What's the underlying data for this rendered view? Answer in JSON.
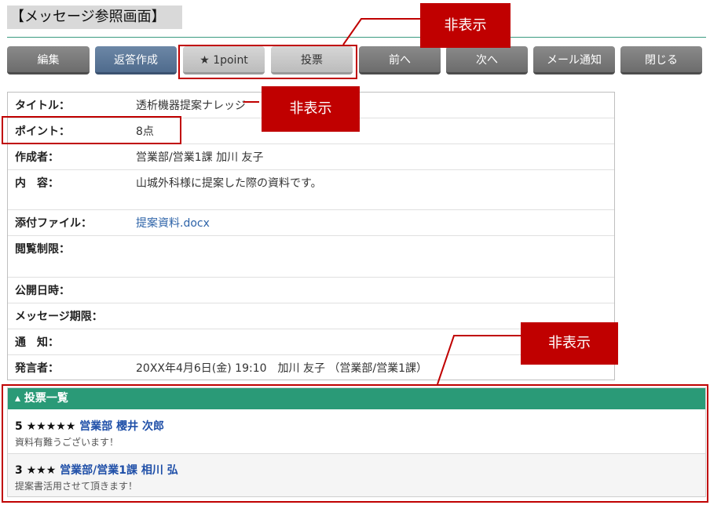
{
  "page": {
    "title": "【メッセージ参照画面】"
  },
  "toolbar": {
    "edit": "編集",
    "reply": "返答作成",
    "point": "★ 1point",
    "vote": "投票",
    "prev": "前へ",
    "next": "次へ",
    "mail_notify": "メール通知",
    "close": "閉じる"
  },
  "callouts": {
    "hidden": "非表示"
  },
  "detail": {
    "title_label": "タイトル：",
    "title_value": "透析機器提案ナレッジ",
    "point_label": "ポイント：",
    "point_value": "8点",
    "author_label": "作成者：",
    "author_value": "営業部/営業1課 加川 友子",
    "content_label": "内　容：",
    "content_value": "山城外科様に提案した際の資料です。",
    "attachment_label": "添付ファイル：",
    "attachment_value": "提案資料.docx",
    "restriction_label": "閲覧制限：",
    "publish_label": "公開日時：",
    "expiry_label": "メッセージ期限：",
    "notify_label": "通　知：",
    "poster_label": "発言者：",
    "poster_value": "20XX年4月6日(金) 19:10　加川 友子 （営業部/営業1課）"
  },
  "votes": {
    "header": "▴ 投票一覧",
    "items": [
      {
        "score": "5 ★★★★★",
        "who": "営業部 櫻井 次郎",
        "comment": "資料有難うございます！"
      },
      {
        "score": "3 ★★★",
        "who": "営業部/営業1課 相川 弘",
        "comment": "提案書活用させて頂きます！"
      }
    ]
  },
  "colors": {
    "accent_green": "#2a9a77",
    "callout_red": "#c00000",
    "link_blue": "#2d63a8"
  }
}
